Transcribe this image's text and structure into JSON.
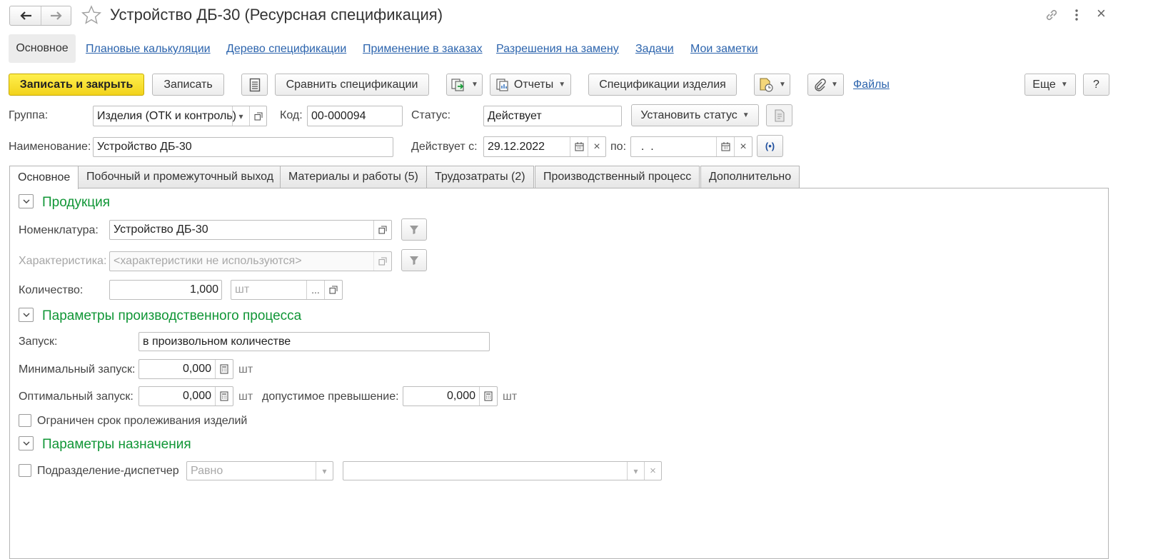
{
  "header": {
    "title": "Устройство ДБ-30 (Ресурсная спецификация)",
    "back_icon": "arrow-left-icon",
    "forward_icon": "arrow-right-icon",
    "star_icon": "star-icon",
    "link_icon": "link-icon",
    "more_icon": "vertical-dots-icon",
    "close_label": "×"
  },
  "nav": {
    "active": "Основное",
    "links": [
      "Плановые калькуляции",
      "Дерево спецификации",
      "Применение в заказах",
      "Разрешения на замену",
      "Задачи",
      "Мои заметки"
    ]
  },
  "toolbar": {
    "save_close": "Записать и закрыть",
    "save": "Записать",
    "compare": "Сравнить спецификации",
    "reports": "Отчеты",
    "product_specs": "Спецификации изделия",
    "files": "Файлы",
    "more": "Еще",
    "help": "?"
  },
  "fields": {
    "group_label": "Группа:",
    "group_value": "Изделия (ОТК и контроль)",
    "code_label": "Код:",
    "code_value": "00-000094",
    "status_label": "Статус:",
    "status_value": "Действует",
    "set_status": "Установить статус",
    "name_label": "Наименование:",
    "name_value": "Устройство ДБ-30",
    "valid_from_label": "Действует с:",
    "valid_from_value": "29.12.2022",
    "valid_to_label": "по:",
    "valid_to_value": "  .  ."
  },
  "tabs": [
    "Основное",
    "Побочный и промежуточный выход",
    "Материалы и работы (5)",
    "Трудозатраты (2)",
    "Производственный процесс",
    "Дополнительно"
  ],
  "product": {
    "title": "Продукция",
    "nomenclature_label": "Номенклатура:",
    "nomenclature_value": "Устройство ДБ-30",
    "characteristic_label": "Характеристика:",
    "characteristic_placeholder": "<характеристики не используются>",
    "quantity_label": "Количество:",
    "quantity_value": "1,000",
    "unit_placeholder": "шт",
    "ellipsis": "..."
  },
  "process": {
    "title": "Параметры производственного процесса",
    "launch_label": "Запуск:",
    "launch_value": "в произвольном количестве",
    "min_label": "Минимальный запуск:",
    "min_value": "0,000",
    "opt_label": "Оптимальный запуск:",
    "opt_value": "0,000",
    "excess_label": "допустимое превышение:",
    "excess_value": "0,000",
    "unit": "шт",
    "shelf_life_label": "Ограничен срок пролеживания изделий"
  },
  "assignment": {
    "title": "Параметры назначения",
    "dispatcher_label": "Подразделение-диспетчер",
    "condition_value": "Равно"
  }
}
